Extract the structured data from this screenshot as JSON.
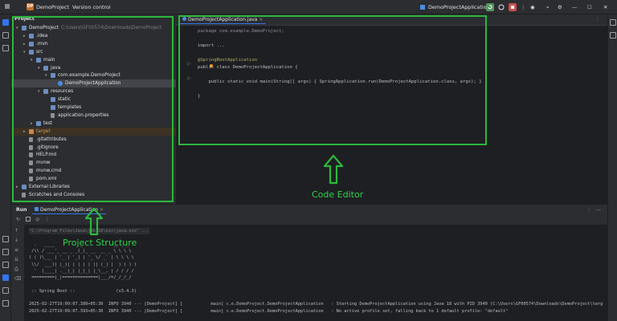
{
  "titlebar": {
    "project_badge": "DP",
    "project_name": "DemoProject",
    "version_control": "Version control",
    "run_config": "DemoProjectApplication"
  },
  "project_panel": {
    "title": "Project",
    "tree": [
      {
        "label": "DemoProject",
        "extra": "C:\\Users\\GF00574\\Downloads\\DemoProject",
        "depth": 0,
        "icon": "folder",
        "arrow": "open"
      },
      {
        "label": ".idea",
        "depth": 1,
        "icon": "folder",
        "arrow": "closed"
      },
      {
        "label": ".mvn",
        "depth": 1,
        "icon": "folder",
        "arrow": "closed"
      },
      {
        "label": "src",
        "depth": 1,
        "icon": "folder",
        "arrow": "open"
      },
      {
        "label": "main",
        "depth": 2,
        "icon": "folder",
        "arrow": "open"
      },
      {
        "label": "java",
        "depth": 3,
        "icon": "folder",
        "arrow": "open"
      },
      {
        "label": "com.example.DemoProject",
        "depth": 4,
        "icon": "folder",
        "arrow": "open"
      },
      {
        "label": "DemoProjectApplication",
        "depth": 5,
        "icon": "java",
        "arrow": "none",
        "selected": true
      },
      {
        "label": "resources",
        "depth": 3,
        "icon": "folder",
        "arrow": "open"
      },
      {
        "label": "static",
        "depth": 4,
        "icon": "folder",
        "arrow": "none"
      },
      {
        "label": "templates",
        "depth": 4,
        "icon": "folder",
        "arrow": "none"
      },
      {
        "label": "application.properties",
        "depth": 4,
        "icon": "file",
        "arrow": "none"
      },
      {
        "label": "test",
        "depth": 2,
        "icon": "folder",
        "arrow": "closed"
      },
      {
        "label": "target",
        "depth": 1,
        "icon": "folder-o",
        "arrow": "closed",
        "excluded": true
      },
      {
        "label": ".gitattributes",
        "depth": 1,
        "icon": "file",
        "arrow": "none"
      },
      {
        "label": ".gitignore",
        "depth": 1,
        "icon": "file",
        "arrow": "none"
      },
      {
        "label": "HELP.md",
        "depth": 1,
        "icon": "file",
        "arrow": "none"
      },
      {
        "label": "mvnw",
        "depth": 1,
        "icon": "file",
        "arrow": "none"
      },
      {
        "label": "mvnw.cmd",
        "depth": 1,
        "icon": "file",
        "arrow": "none"
      },
      {
        "label": "pom.xml",
        "depth": 1,
        "icon": "file",
        "arrow": "none"
      },
      {
        "label": "External Libraries",
        "depth": 0,
        "icon": "folder",
        "arrow": "closed"
      },
      {
        "label": "Scratches and Consoles",
        "depth": 0,
        "icon": "file",
        "arrow": "none"
      }
    ]
  },
  "editor": {
    "tab": "DemoProjectApplication.java",
    "lines": [
      "package com.example.DemoProject;",
      "",
      "import ...",
      "",
      "@SpringBootApplication",
      "public class DemoProjectApplication {",
      "",
      "    public static void main(String[] args) { SpringApplication.run(DemoProjectApplication.class, args); }",
      "",
      "}"
    ]
  },
  "run_panel": {
    "title": "Run",
    "tab": "DemoProjectApplication",
    "console": [
      "\"C:\\Program Files\\Java\\jdk-18\\bin\\java.exe\" ...",
      "",
      "  .   ____          _            __ _ _",
      " /\\\\ / ___'_ __ _ _(_)_ __  __ _ \\ \\ \\ \\",
      "( ( )\\___ | '_ | '_| | '_ \\/ _` | \\ \\ \\ \\",
      " \\\\/  ___)| |_)| | | | | || (_| |  ) ) ) )",
      "  '  |____| .__|_| |_|_| |_\\__, | / / / /",
      " =========|_|==============|___/=/_/_/_/",
      "",
      " :: Spring Boot ::                (v3.4.3)",
      "",
      "2025-02-27T19:09:07.389+05:30  INFO 3940 --- [DemoProject] [           main] c.e.DemoProject.DemoProjectApplication   : Starting DemoProjectApplication using Java 18 with PID 3940 (C:\\Users\\GF00574\\Downloads\\DemoProject\\targ",
      "2025-02-27T19:09:07.393+05:30  INFO 3940 --- [DemoProject] [           main] c.e.DemoProject.DemoProjectApplication   : No active profile set, falling back to 1 default profile: \"default\""
    ]
  },
  "annotations": {
    "project_structure": "Project Structure",
    "code_editor": "Code Editor",
    "color": "#2db83d"
  }
}
